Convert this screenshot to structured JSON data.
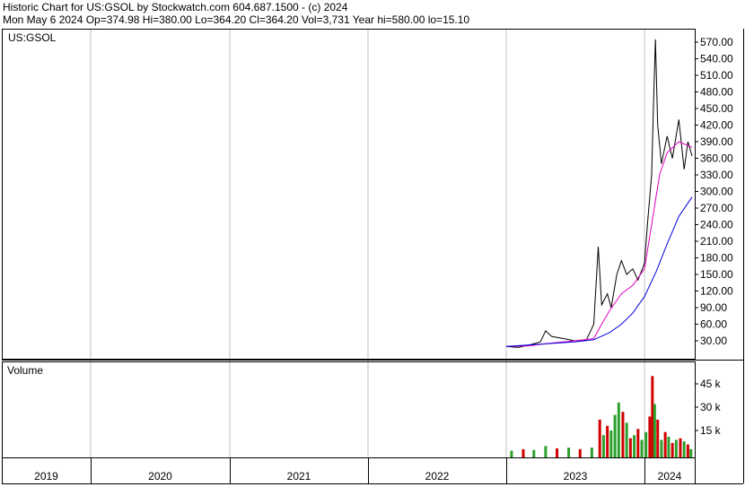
{
  "header": {
    "line1": "Historic Chart for US:GSOL by Stockwatch.com 604.687.1500 - (c) 2024",
    "line2": "Mon May  6 2024   Op=374.98  Hi=380.00  Lo=364.20  Cl=364.20  Vol=3,731  Year hi=580.00  lo=15.10"
  },
  "colors": {
    "price": "#000000",
    "ma_short": "#e000c0",
    "ma_long": "#0000e0",
    "vol_up": "#2ca02c",
    "vol_down": "#d00000",
    "grid": "#c0c0c0"
  },
  "chart_data": [
    {
      "type": "line",
      "panel": "price",
      "label": "US:GSOL",
      "x_labels": [
        "2019",
        "2020",
        "2021",
        "2022",
        "2023",
        "2024"
      ],
      "yticks": [
        30,
        60,
        90,
        120,
        150,
        180,
        210,
        240,
        270,
        300,
        330,
        360,
        390,
        420,
        450,
        480,
        510,
        540,
        570
      ],
      "ylim": [
        0,
        590
      ],
      "series": [
        {
          "kind": "price",
          "x": [
            "2023-01-01",
            "2023-02-01",
            "2023-03-01",
            "2023-04-01",
            "2023-04-15",
            "2023-05-01",
            "2023-06-01",
            "2023-07-01",
            "2023-08-01",
            "2023-08-20",
            "2023-09-01",
            "2023-09-10",
            "2023-09-25",
            "2023-10-05",
            "2023-10-20",
            "2023-11-01",
            "2023-11-15",
            "2023-12-01",
            "2023-12-15",
            "2024-01-01",
            "2024-01-10",
            "2024-01-20",
            "2024-01-25",
            "2024-01-30",
            "2024-02-05",
            "2024-02-15",
            "2024-03-01",
            "2024-03-15",
            "2024-04-01",
            "2024-04-15",
            "2024-04-25",
            "2024-05-06"
          ],
          "y": [
            20,
            18,
            22,
            28,
            48,
            38,
            34,
            30,
            32,
            60,
            200,
            95,
            115,
            90,
            150,
            175,
            150,
            160,
            140,
            170,
            250,
            330,
            460,
            575,
            420,
            350,
            400,
            360,
            430,
            340,
            390,
            364
          ]
        },
        {
          "kind": "moving-average-short",
          "x": [
            "2023-01-01",
            "2023-03-01",
            "2023-05-01",
            "2023-07-01",
            "2023-08-20",
            "2023-09-10",
            "2023-10-01",
            "2023-11-01",
            "2023-12-01",
            "2024-01-01",
            "2024-01-20",
            "2024-02-10",
            "2024-03-01",
            "2024-04-01",
            "2024-05-06"
          ],
          "y": [
            20,
            21,
            26,
            30,
            34,
            60,
            85,
            115,
            130,
            160,
            240,
            330,
            370,
            390,
            380
          ]
        },
        {
          "kind": "moving-average-long",
          "x": [
            "2023-01-01",
            "2023-04-01",
            "2023-07-01",
            "2023-08-20",
            "2023-10-01",
            "2023-11-01",
            "2023-12-01",
            "2024-01-01",
            "2024-02-01",
            "2024-03-01",
            "2024-04-01",
            "2024-05-06"
          ],
          "y": [
            20,
            24,
            28,
            32,
            45,
            60,
            80,
            110,
            155,
            205,
            255,
            290
          ]
        }
      ]
    },
    {
      "type": "bar",
      "panel": "volume",
      "label": "Volume",
      "yticks": [
        15000,
        30000,
        45000
      ],
      "ytick_labels": [
        "15 k",
        "30 k",
        "45 k"
      ],
      "ylim": [
        0,
        52000
      ],
      "x": [
        "2023-01-15",
        "2023-02-15",
        "2023-03-15",
        "2023-04-15",
        "2023-05-15",
        "2023-06-15",
        "2023-07-15",
        "2023-08-15",
        "2023-09-05",
        "2023-09-15",
        "2023-09-25",
        "2023-10-05",
        "2023-10-15",
        "2023-10-25",
        "2023-11-05",
        "2023-11-15",
        "2023-11-25",
        "2023-12-05",
        "2023-12-15",
        "2023-12-25",
        "2024-01-05",
        "2024-01-15",
        "2024-01-22",
        "2024-01-28",
        "2024-02-05",
        "2024-02-15",
        "2024-02-25",
        "2024-03-05",
        "2024-03-15",
        "2024-03-25",
        "2024-04-05",
        "2024-04-15",
        "2024-04-25",
        "2024-05-03"
      ],
      "values": [
        2000,
        3000,
        2500,
        5000,
        3500,
        4000,
        3000,
        4000,
        22000,
        12000,
        18000,
        15000,
        25000,
        33000,
        27000,
        20000,
        10000,
        12000,
        16000,
        9000,
        14000,
        24000,
        50000,
        32000,
        22000,
        9000,
        14000,
        11000,
        7000,
        9000,
        10000,
        8000,
        6000,
        3000
      ],
      "up": [
        true,
        false,
        true,
        true,
        false,
        true,
        false,
        true,
        false,
        true,
        false,
        true,
        true,
        true,
        false,
        true,
        false,
        true,
        false,
        true,
        true,
        false,
        false,
        true,
        false,
        true,
        false,
        true,
        false,
        true,
        false,
        true,
        false,
        true
      ]
    }
  ]
}
